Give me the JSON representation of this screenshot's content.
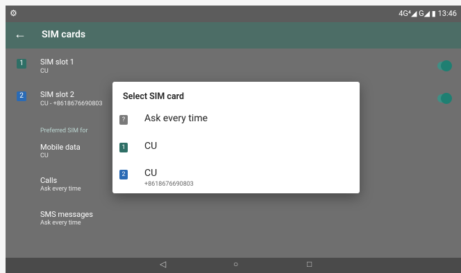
{
  "status_bar": {
    "left_icon": "gear-icon",
    "right_text": "4G⁴◢ G◢ ▮ 13:46"
  },
  "app_bar": {
    "back_icon": "back-arrow-icon",
    "title": "SIM cards"
  },
  "sim_slots": [
    {
      "title": "SIM slot 1",
      "subtitle": "CU",
      "badge": "1",
      "icon": "sim-card-icon"
    },
    {
      "title": "SIM slot 2",
      "subtitle": "CU - +8618676690803",
      "badge": "2",
      "icon": "sim-card-icon"
    }
  ],
  "preferred": {
    "label": "Preferred SIM for",
    "items": [
      {
        "title": "Mobile data",
        "subtitle": "CU"
      },
      {
        "title": "Calls",
        "subtitle": "Ask every time"
      },
      {
        "title": "SMS messages",
        "subtitle": "Ask every time"
      }
    ]
  },
  "dialog": {
    "title": "Select SIM card",
    "options": [
      {
        "label": "Ask every time",
        "badge": "?",
        "sub": ""
      },
      {
        "label": "CU",
        "badge": "1",
        "sub": ""
      },
      {
        "label": "CU",
        "badge": "2",
        "sub": "+8618676690803"
      }
    ]
  },
  "nav": {
    "back": "◁",
    "home": "○",
    "recents": "□"
  }
}
